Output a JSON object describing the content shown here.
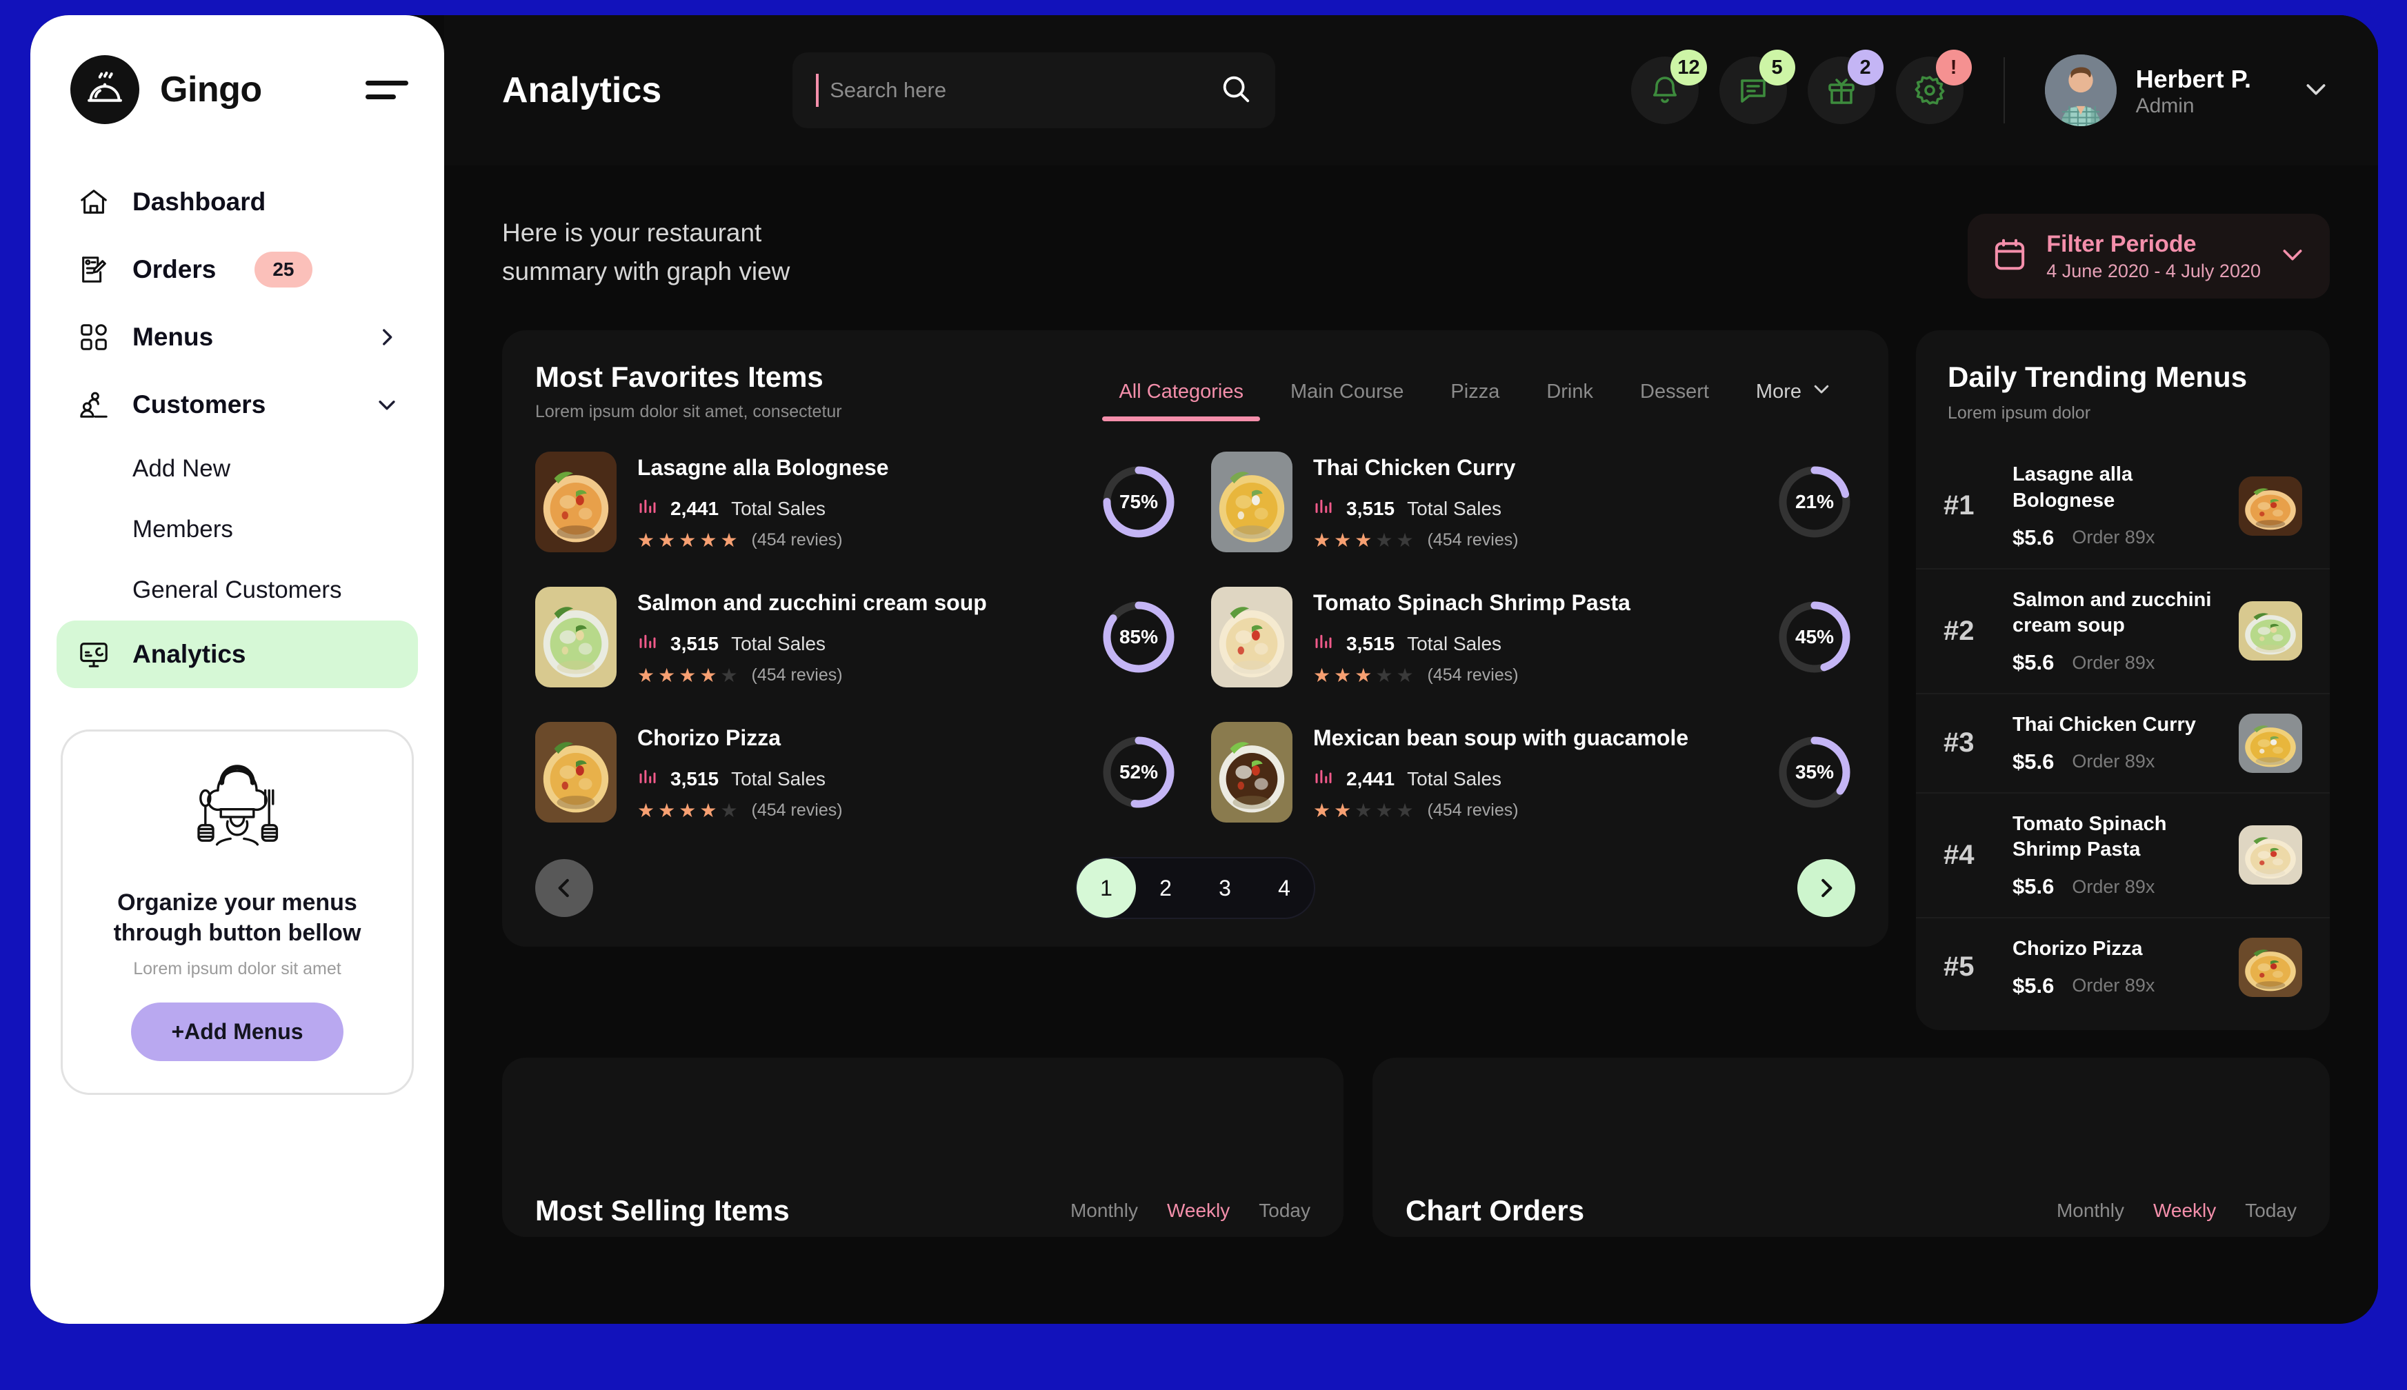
{
  "brand": {
    "name": "Gingo",
    "logo_icon": "food-dome-icon",
    "menu_icon": "hamburger-icon"
  },
  "sidebar": {
    "items": [
      {
        "label": "Dashboard",
        "icon": "home-icon",
        "active": false
      },
      {
        "label": "Orders",
        "icon": "order-edit-icon",
        "badge": "25",
        "active": false
      },
      {
        "label": "Menus",
        "icon": "grid-icon",
        "chevron": "chevron-right-icon",
        "active": false
      },
      {
        "label": "Customers",
        "icon": "users-icon",
        "chevron": "chevron-down-icon",
        "active": false
      }
    ],
    "sub_items": [
      {
        "label": "Add New"
      },
      {
        "label": "Members"
      },
      {
        "label": "General Customers"
      }
    ],
    "analytics": {
      "label": "Analytics",
      "icon": "monitor-chart-icon",
      "active": true
    },
    "promo": {
      "art_icon": "chef-icon",
      "title": "Organize your menus through button bellow",
      "subtitle": "Lorem ipsum dolor sit amet",
      "button_label": "+Add Menus"
    }
  },
  "header": {
    "title": "Analytics",
    "search": {
      "placeholder": "Search here",
      "value": "",
      "icon": "search-icon"
    },
    "icons": [
      {
        "name": "bell-icon",
        "badge": "12",
        "badge_color": "#cdf5a6"
      },
      {
        "name": "chat-icon",
        "badge": "5",
        "badge_color": "#cdf5a6"
      },
      {
        "name": "gift-icon",
        "badge": "2",
        "badge_color": "#c4b5f5"
      },
      {
        "name": "gear-icon",
        "badge": "!",
        "badge_color": "#f59191"
      }
    ],
    "user": {
      "name": "Herbert P.",
      "role": "Admin",
      "chevron": "chevron-down-icon"
    }
  },
  "subheader": {
    "summary_line1": "Here is your restaurant",
    "summary_line2": "summary with graph view",
    "filter": {
      "icon": "calendar-icon",
      "title": "Filter Periode",
      "range": "4 June 2020 - 4 July 2020",
      "chevron": "chevron-down-icon"
    }
  },
  "favorites": {
    "title": "Most Favorites Items",
    "subtitle": "Lorem ipsum dolor sit amet, consectetur",
    "tabs": [
      {
        "label": "All Categories",
        "active": true
      },
      {
        "label": "Main Course",
        "active": false
      },
      {
        "label": "Pizza",
        "active": false
      },
      {
        "label": "Drink",
        "active": false
      },
      {
        "label": "Dessert",
        "active": false
      }
    ],
    "more_label": "More",
    "sales_label": "Total Sales",
    "sales_icon": "bar-chart-icon",
    "items": [
      {
        "name": "Lasagne alla Bolognese",
        "sales": "2,441",
        "stars": 5,
        "reviews": "(454 revies)",
        "percent": 75,
        "image": "lasagne"
      },
      {
        "name": "Thai Chicken Curry",
        "sales": "3,515",
        "stars": 3,
        "reviews": "(454 revies)",
        "percent": 21,
        "image": "curry"
      },
      {
        "name": "Salmon and zucchini cream soup",
        "sales": "3,515",
        "stars": 4,
        "reviews": "(454 revies)",
        "percent": 85,
        "image": "soup"
      },
      {
        "name": "Tomato Spinach Shrimp Pasta",
        "sales": "3,515",
        "stars": 3,
        "reviews": "(454 revies)",
        "percent": 45,
        "image": "pasta"
      },
      {
        "name": "Chorizo Pizza",
        "sales": "3,515",
        "stars": 4,
        "reviews": "(454 revies)",
        "percent": 52,
        "image": "pizza"
      },
      {
        "name": "Mexican bean soup with guacamole",
        "sales": "2,441",
        "stars": 2,
        "reviews": "(454 revies)",
        "percent": 35,
        "image": "beansoup"
      }
    ],
    "pagination": {
      "prev_icon": "chevron-left-icon",
      "next_icon": "chevron-right-icon",
      "pages": [
        "1",
        "2",
        "3",
        "4"
      ],
      "current": "1"
    }
  },
  "trending": {
    "title": "Daily Trending Menus",
    "subtitle": "Lorem ipsum dolor",
    "items": [
      {
        "rank": "#1",
        "name": "Lasagne alla Bolognese",
        "price": "$5.6",
        "orders": "Order 89x",
        "image": "lasagne"
      },
      {
        "rank": "#2",
        "name": "Salmon and zucchini cream soup",
        "price": "$5.6",
        "orders": "Order 89x",
        "image": "soup"
      },
      {
        "rank": "#3",
        "name": "Thai Chicken Curry",
        "price": "$5.6",
        "orders": "Order 89x",
        "image": "curry"
      },
      {
        "rank": "#4",
        "name": "Tomato Spinach Shrimp Pasta",
        "price": "$5.6",
        "orders": "Order 89x",
        "image": "pasta"
      },
      {
        "rank": "#5",
        "name": "Chorizo Pizza",
        "price": "$5.6",
        "orders": "Order 89x",
        "image": "pizza"
      }
    ]
  },
  "bottom": {
    "selling": {
      "title": "Most Selling Items",
      "filters": [
        {
          "label": "Monthly",
          "active": false
        },
        {
          "label": "Weekly",
          "active": true
        },
        {
          "label": "Today",
          "active": false
        }
      ]
    },
    "orders": {
      "title": "Chart Orders",
      "filters": [
        {
          "label": "Monthly",
          "active": false
        },
        {
          "label": "Weekly",
          "active": true
        },
        {
          "label": "Today",
          "active": false
        }
      ]
    }
  },
  "colors": {
    "accent_pink": "#f48fab",
    "accent_green": "#cdf5a6",
    "accent_purple": "#c4b5f5",
    "badge_red": "#f59191",
    "page_background": "#1212bb",
    "surface": "#131313"
  }
}
